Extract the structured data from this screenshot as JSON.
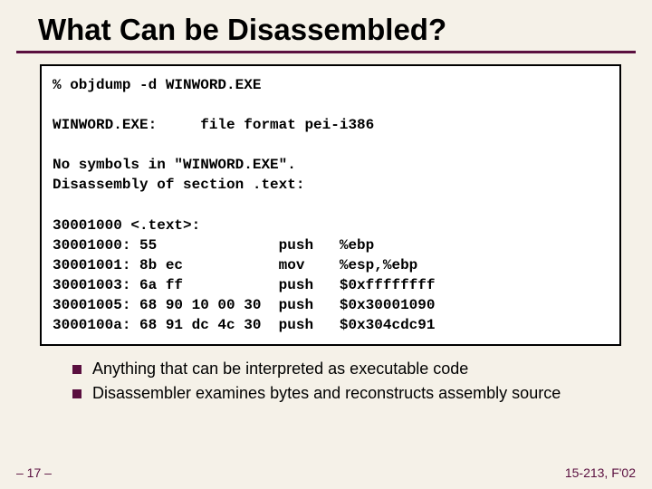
{
  "title": "What Can be Disassembled?",
  "code": {
    "l1": "% objdump -d WINWORD.EXE",
    "l2": "",
    "l3": "WINWORD.EXE:     file format pei-i386",
    "l4": "",
    "l5": "No symbols in \"WINWORD.EXE\".",
    "l6": "Disassembly of section .text:",
    "l7": "",
    "l8": "30001000 <.text>:",
    "l9": "30001000: 55              push   %ebp",
    "l10": "30001001: 8b ec           mov    %esp,%ebp",
    "l11": "30001003: 6a ff           push   $0xffffffff",
    "l12": "30001005: 68 90 10 00 30  push   $0x30001090",
    "l13": "3000100a: 68 91 dc 4c 30  push   $0x304cdc91"
  },
  "bullets": {
    "b1": "Anything that can be interpreted as executable code",
    "b2": "Disassembler examines bytes and reconstructs assembly source"
  },
  "footer": {
    "left": "– 17 –",
    "right": "15-213, F'02"
  }
}
